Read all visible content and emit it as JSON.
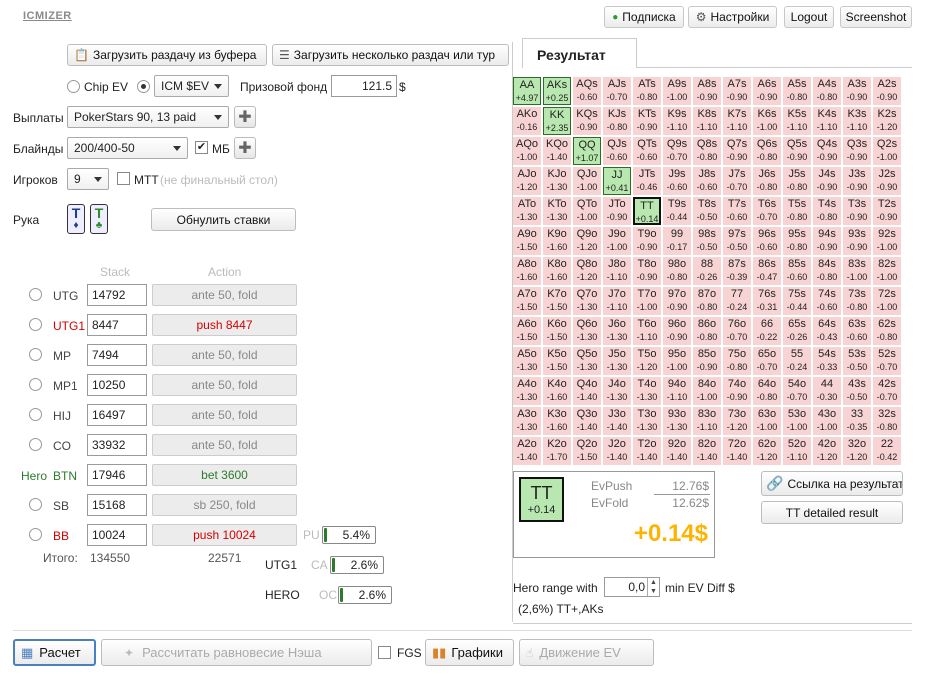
{
  "app": {
    "logo": "ICMIZER"
  },
  "top_nav": {
    "subscribe": "Подписка",
    "settings": "Настройки",
    "logout": "Logout",
    "screenshot": "Screenshot"
  },
  "colors": {
    "green": "#2d7a2d",
    "red": "#d40000",
    "cell_red": "#f7d3d3",
    "cell_green": "#b8e8b0",
    "orange": "#ffb300"
  },
  "import": {
    "from_clipboard": "Загрузить раздачу из буфера",
    "multiple": "Загрузить несколько раздач или тур"
  },
  "settings": {
    "chip_ev": "Chip EV",
    "icm_ev": "ICM $EV",
    "prize_label": "Призовой фонд",
    "prize_value": "121.5",
    "currency": "$",
    "payouts_label": "Выплаты",
    "payouts_value": "PokerStars 90, 13 paid",
    "blinds_label": "Блайнды",
    "blinds_value": "200/400-50",
    "mb_label": "МБ",
    "players_label": "Игроков",
    "players_value": "9",
    "mtt_label": "МТТ",
    "mtt_hint": "(не финальный стол)"
  },
  "hand": {
    "label": "Рука",
    "card1": "T",
    "card2": "T",
    "reset": "Обнулить ставки"
  },
  "table_headers": {
    "stack": "Stack",
    "action": "Action"
  },
  "players": [
    {
      "pos": "UTG",
      "stack": "14792",
      "action": "ante 50, fold",
      "style": "fold"
    },
    {
      "pos": "UTG1",
      "stack": "8447",
      "action": "push 8447",
      "style": "push"
    },
    {
      "pos": "MP",
      "stack": "7494",
      "action": "ante 50, fold",
      "style": "fold"
    },
    {
      "pos": "MP1",
      "stack": "10250",
      "action": "ante 50, fold",
      "style": "fold"
    },
    {
      "pos": "HIJ",
      "stack": "16497",
      "action": "ante 50, fold",
      "style": "fold"
    },
    {
      "pos": "CO",
      "stack": "33932",
      "action": "ante 50, fold",
      "style": "fold"
    },
    {
      "pos": "BTN",
      "hero": "Hero",
      "stack": "17946",
      "action": "bet 3600",
      "style": "bet"
    },
    {
      "pos": "SB",
      "stack": "15168",
      "action": "sb 250, fold",
      "style": "fold"
    },
    {
      "pos": "BB",
      "stack": "10024",
      "action": "push 10024",
      "style": "push"
    }
  ],
  "totals": {
    "label": "Итого:",
    "stack": "134550",
    "pot": "22571"
  },
  "ranges": [
    {
      "label": "",
      "tag": "PU",
      "value": "5.4%",
      "pct": 5.4
    },
    {
      "label": "UTG1",
      "tag": "CA",
      "value": "2.6%",
      "pct": 2.6
    },
    {
      "label": "HERO",
      "tag": "OC",
      "value": "2.6%",
      "pct": 2.6
    }
  ],
  "result": {
    "title": "Результат",
    "hand": "TT",
    "hand_ev": "+0.14",
    "evpush_label": "EvPush",
    "evpush": "12.76$",
    "evfold_label": "EvFold",
    "evfold": "12.62$",
    "diff": "+0.14$",
    "link_btn": "Ссылка на результат",
    "detail_btn": "TT detailed result",
    "range_label": "Hero range with",
    "range_input": "0,0",
    "range_suffix": "min EV Diff $",
    "range_text": "(2,6%) TT+,AKs"
  },
  "grid": [
    [
      [
        "AA",
        "+4.97",
        "g"
      ],
      [
        "AKs",
        "+0.25",
        "g"
      ],
      [
        "AQs",
        "-0.60"
      ],
      [
        "AJs",
        "-0.70"
      ],
      [
        "ATs",
        "-0.80"
      ],
      [
        "A9s",
        "-1.00"
      ],
      [
        "A8s",
        "-0.90"
      ],
      [
        "A7s",
        "-0.90"
      ],
      [
        "A6s",
        "-0.90"
      ],
      [
        "A5s",
        "-0.80"
      ],
      [
        "A4s",
        "-0.80"
      ],
      [
        "A3s",
        "-0.90"
      ],
      [
        "A2s",
        "-0.90"
      ]
    ],
    [
      [
        "AKo",
        "-0.16"
      ],
      [
        "KK",
        "+2.35",
        "g"
      ],
      [
        "KQs",
        "-0.90"
      ],
      [
        "KJs",
        "-0.80"
      ],
      [
        "KTs",
        "-0.90"
      ],
      [
        "K9s",
        "-1.10"
      ],
      [
        "K8s",
        "-1.10"
      ],
      [
        "K7s",
        "-1.10"
      ],
      [
        "K6s",
        "-1.00"
      ],
      [
        "K5s",
        "-1.10"
      ],
      [
        "K4s",
        "-1.10"
      ],
      [
        "K3s",
        "-1.10"
      ],
      [
        "K2s",
        "-1.20"
      ]
    ],
    [
      [
        "AQo",
        "-1.00"
      ],
      [
        "KQo",
        "-1.40"
      ],
      [
        "QQ",
        "+1.07",
        "g"
      ],
      [
        "QJs",
        "-0.60"
      ],
      [
        "QTs",
        "-0.60"
      ],
      [
        "Q9s",
        "-0.70"
      ],
      [
        "Q8s",
        "-0.80"
      ],
      [
        "Q7s",
        "-0.90"
      ],
      [
        "Q6s",
        "-0.80"
      ],
      [
        "Q5s",
        "-0.90"
      ],
      [
        "Q4s",
        "-0.90"
      ],
      [
        "Q3s",
        "-0.90"
      ],
      [
        "Q2s",
        "-1.00"
      ]
    ],
    [
      [
        "AJo",
        "-1.20"
      ],
      [
        "KJo",
        "-1.30"
      ],
      [
        "QJo",
        "-1.00"
      ],
      [
        "JJ",
        "+0.41",
        "g"
      ],
      [
        "JTs",
        "-0.46"
      ],
      [
        "J9s",
        "-0.60"
      ],
      [
        "J8s",
        "-0.60"
      ],
      [
        "J7s",
        "-0.70"
      ],
      [
        "J6s",
        "-0.80"
      ],
      [
        "J5s",
        "-0.80"
      ],
      [
        "J4s",
        "-0.90"
      ],
      [
        "J3s",
        "-0.90"
      ],
      [
        "J2s",
        "-0.90"
      ]
    ],
    [
      [
        "ATo",
        "-1.30"
      ],
      [
        "KTo",
        "-1.30"
      ],
      [
        "QTo",
        "-1.00"
      ],
      [
        "JTo",
        "-0.90"
      ],
      [
        "TT",
        "+0.14",
        "gs"
      ],
      [
        "T9s",
        "-0.44"
      ],
      [
        "T8s",
        "-0.50"
      ],
      [
        "T7s",
        "-0.60"
      ],
      [
        "T6s",
        "-0.70"
      ],
      [
        "T5s",
        "-0.80"
      ],
      [
        "T4s",
        "-0.80"
      ],
      [
        "T3s",
        "-0.90"
      ],
      [
        "T2s",
        "-0.90"
      ]
    ],
    [
      [
        "A9o",
        "-1.50"
      ],
      [
        "K9o",
        "-1.60"
      ],
      [
        "Q9o",
        "-1.20"
      ],
      [
        "J9o",
        "-1.00"
      ],
      [
        "T9o",
        "-0.90"
      ],
      [
        "99",
        "-0.17"
      ],
      [
        "98s",
        "-0.50"
      ],
      [
        "97s",
        "-0.50"
      ],
      [
        "96s",
        "-0.60"
      ],
      [
        "95s",
        "-0.80"
      ],
      [
        "94s",
        "-0.90"
      ],
      [
        "93s",
        "-0.90"
      ],
      [
        "92s",
        "-1.00"
      ]
    ],
    [
      [
        "A8o",
        "-1.60"
      ],
      [
        "K8o",
        "-1.60"
      ],
      [
        "Q8o",
        "-1.20"
      ],
      [
        "J8o",
        "-1.10"
      ],
      [
        "T8o",
        "-0.90"
      ],
      [
        "98o",
        "-0.80"
      ],
      [
        "88",
        "-0.26"
      ],
      [
        "87s",
        "-0.39"
      ],
      [
        "86s",
        "-0.47"
      ],
      [
        "85s",
        "-0.60"
      ],
      [
        "84s",
        "-0.80"
      ],
      [
        "83s",
        "-1.00"
      ],
      [
        "82s",
        "-1.00"
      ]
    ],
    [
      [
        "A7o",
        "-1.50"
      ],
      [
        "K7o",
        "-1.50"
      ],
      [
        "Q7o",
        "-1.30"
      ],
      [
        "J7o",
        "-1.10"
      ],
      [
        "T7o",
        "-1.00"
      ],
      [
        "97o",
        "-0.90"
      ],
      [
        "87o",
        "-0.80"
      ],
      [
        "77",
        "-0.24"
      ],
      [
        "76s",
        "-0.31"
      ],
      [
        "75s",
        "-0.44"
      ],
      [
        "74s",
        "-0.60"
      ],
      [
        "73s",
        "-0.80"
      ],
      [
        "72s",
        "-1.00"
      ]
    ],
    [
      [
        "A6o",
        "-1.50"
      ],
      [
        "K6o",
        "-1.50"
      ],
      [
        "Q6o",
        "-1.30"
      ],
      [
        "J6o",
        "-1.30"
      ],
      [
        "T6o",
        "-1.10"
      ],
      [
        "96o",
        "-0.90"
      ],
      [
        "86o",
        "-0.80"
      ],
      [
        "76o",
        "-0.70"
      ],
      [
        "66",
        "-0.22"
      ],
      [
        "65s",
        "-0.26"
      ],
      [
        "64s",
        "-0.43"
      ],
      [
        "63s",
        "-0.60"
      ],
      [
        "62s",
        "-0.80"
      ]
    ],
    [
      [
        "A5o",
        "-1.30"
      ],
      [
        "K5o",
        "-1.50"
      ],
      [
        "Q5o",
        "-1.30"
      ],
      [
        "J5o",
        "-1.30"
      ],
      [
        "T5o",
        "-1.20"
      ],
      [
        "95o",
        "-1.00"
      ],
      [
        "85o",
        "-0.90"
      ],
      [
        "75o",
        "-0.80"
      ],
      [
        "65o",
        "-0.70"
      ],
      [
        "55",
        "-0.24"
      ],
      [
        "54s",
        "-0.33"
      ],
      [
        "53s",
        "-0.50"
      ],
      [
        "52s",
        "-0.70"
      ]
    ],
    [
      [
        "A4o",
        "-1.30"
      ],
      [
        "K4o",
        "-1.60"
      ],
      [
        "Q4o",
        "-1.40"
      ],
      [
        "J4o",
        "-1.30"
      ],
      [
        "T4o",
        "-1.30"
      ],
      [
        "94o",
        "-1.10"
      ],
      [
        "84o",
        "-1.00"
      ],
      [
        "74o",
        "-0.90"
      ],
      [
        "64o",
        "-0.80"
      ],
      [
        "54o",
        "-0.70"
      ],
      [
        "44",
        "-0.30"
      ],
      [
        "43s",
        "-0.50"
      ],
      [
        "42s",
        "-0.70"
      ]
    ],
    [
      [
        "A3o",
        "-1.30"
      ],
      [
        "K3o",
        "-1.60"
      ],
      [
        "Q3o",
        "-1.40"
      ],
      [
        "J3o",
        "-1.40"
      ],
      [
        "T3o",
        "-1.30"
      ],
      [
        "93o",
        "-1.30"
      ],
      [
        "83o",
        "-1.10"
      ],
      [
        "73o",
        "-1.20"
      ],
      [
        "63o",
        "-1.00"
      ],
      [
        "53o",
        "-1.00"
      ],
      [
        "43o",
        "-1.00"
      ],
      [
        "33",
        "-0.35"
      ],
      [
        "32s",
        "-0.80"
      ]
    ],
    [
      [
        "A2o",
        "-1.40"
      ],
      [
        "K2o",
        "-1.70"
      ],
      [
        "Q2o",
        "-1.50"
      ],
      [
        "J2o",
        "-1.40"
      ],
      [
        "T2o",
        "-1.40"
      ],
      [
        "92o",
        "-1.40"
      ],
      [
        "82o",
        "-1.40"
      ],
      [
        "72o",
        "-1.40"
      ],
      [
        "62o",
        "-1.20"
      ],
      [
        "52o",
        "-1.10"
      ],
      [
        "42o",
        "-1.20"
      ],
      [
        "32o",
        "-1.20"
      ],
      [
        "22",
        "-0.42"
      ]
    ]
  ],
  "bottom": {
    "calc": "Расчет",
    "nash": "Рассчитать равновесие Нэша",
    "fgs": "FGS",
    "charts": "Графики",
    "ev_move": "Движение EV"
  }
}
